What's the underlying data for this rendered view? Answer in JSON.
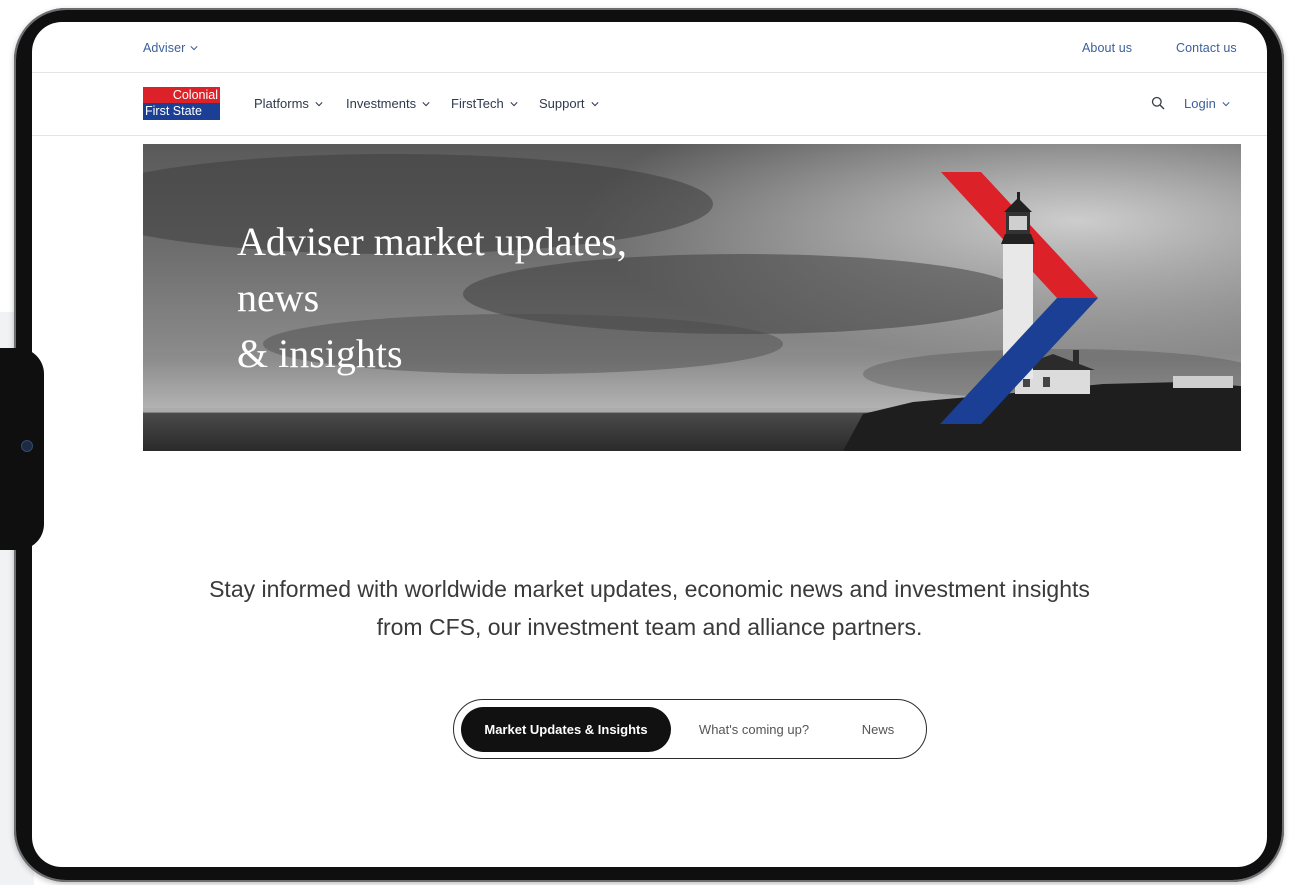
{
  "utility_bar": {
    "audience_selector": "Adviser",
    "links": [
      "About us",
      "Contact us"
    ]
  },
  "logo": {
    "line1": "Colonial",
    "line2": "First State",
    "colors": {
      "red": "#dc2128",
      "blue": "#1b3f94"
    }
  },
  "nav": {
    "items": [
      "Platforms",
      "Investments",
      "FirstTech",
      "Support"
    ],
    "login": "Login"
  },
  "hero": {
    "title_lines": [
      "Adviser market updates,",
      "news",
      "& insights"
    ]
  },
  "intro": {
    "lines": [
      "Stay informed with worldwide market updates, economic news and investment insights",
      "from CFS, our investment team and alliance partners."
    ]
  },
  "tabs": {
    "items": [
      "Market Updates & Insights",
      "What's coming up?",
      "News"
    ],
    "active": "Market Updates & Insights"
  },
  "icons": {
    "search": "search-icon",
    "chevron": "chevron-down-icon"
  }
}
